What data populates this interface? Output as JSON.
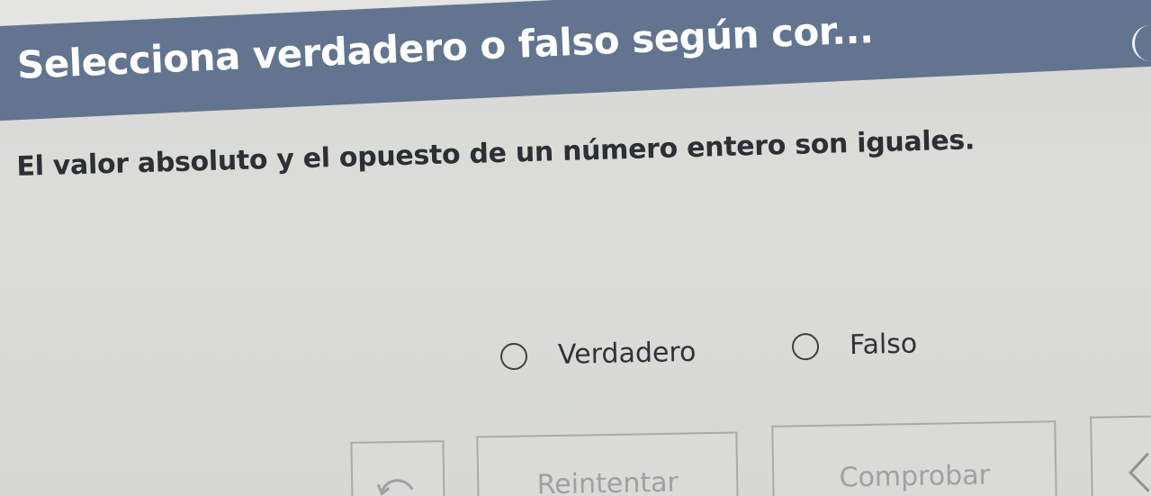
{
  "header": {
    "title": "Selecciona verdadero o falso según cor..."
  },
  "question": {
    "text": "El valor absoluto y el opuesto de un número entero son iguales."
  },
  "options": [
    {
      "label": "Verdadero",
      "selected": false
    },
    {
      "label": "Falso",
      "selected": false
    }
  ],
  "buttons": {
    "undo_icon": "undo-arrow-icon",
    "retry_label": "Reintentar",
    "check_label": "Comprobar",
    "prev_icon": "chevron-left-icon"
  },
  "colors": {
    "header_bg": "#62748f",
    "header_text": "#ffffff",
    "body_text": "#2c2f33",
    "disabled_text": "#9ea1a4"
  }
}
